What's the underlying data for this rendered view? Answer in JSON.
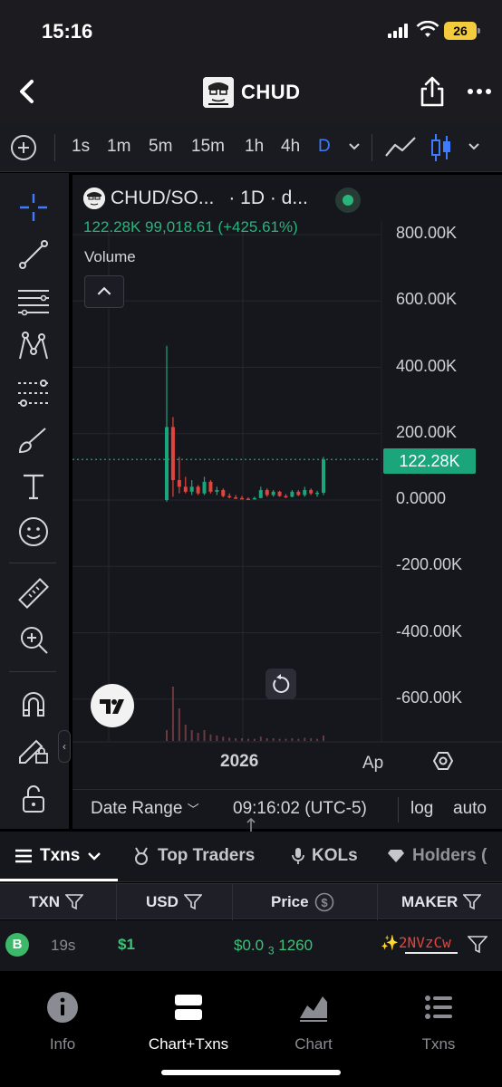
{
  "status": {
    "time": "15:16",
    "battery": "26"
  },
  "header": {
    "title": "CHUD"
  },
  "toolbar": {
    "timeframes": [
      "1s",
      "1m",
      "5m",
      "15m",
      "1h",
      "4h",
      "D"
    ],
    "active_timeframe": "D"
  },
  "chart": {
    "pair": "CHUD/SO...",
    "interval": "· 1D · d...",
    "ohlc": "122.28K  99,018.61 (+425.61%)",
    "volume_label": "Volume",
    "y_ticks": [
      "800.00K",
      "600.00K",
      "400.00K",
      "200.00K",
      "0.0000",
      "-200.00K",
      "-400.00K",
      "-600.00K"
    ],
    "last_price_tag": "122.28K",
    "x_ticks": [
      "2026",
      "Ap"
    ],
    "date_range": "Date Range",
    "time": "09:16:02 (UTC-5)",
    "log": "log",
    "auto": "auto"
  },
  "chart_data": {
    "type": "candlestick",
    "title": "CHUD/SO... · 1D",
    "ylim": [
      -700000,
      900000
    ],
    "y_ticks": [
      800000,
      600000,
      400000,
      200000,
      0,
      -200000,
      -400000,
      -600000
    ],
    "x_ticks": [
      "2026",
      "Ap"
    ],
    "last_value": 122280,
    "series": [
      {
        "name": "Price",
        "values": [
          {
            "o": 0,
            "h": 465000,
            "l": -5000,
            "c": 220000
          },
          {
            "o": 220000,
            "h": 250000,
            "l": 10000,
            "c": 60000
          },
          {
            "o": 60000,
            "h": 130000,
            "l": 20000,
            "c": 40000
          },
          {
            "o": 40000,
            "h": 70000,
            "l": 20000,
            "c": 25000
          },
          {
            "o": 25000,
            "h": 60000,
            "l": 15000,
            "c": 40000
          },
          {
            "o": 40000,
            "h": 45000,
            "l": 15000,
            "c": 20000
          },
          {
            "o": 20000,
            "h": 70000,
            "l": 15000,
            "c": 55000
          },
          {
            "o": 55000,
            "h": 60000,
            "l": 20000,
            "c": 25000
          },
          {
            "o": 25000,
            "h": 40000,
            "l": 15000,
            "c": 30000
          },
          {
            "o": 30000,
            "h": 35000,
            "l": 8000,
            "c": 12000
          },
          {
            "o": 12000,
            "h": 20000,
            "l": 5000,
            "c": 8000
          },
          {
            "o": 8000,
            "h": 15000,
            "l": 3000,
            "c": 6000
          },
          {
            "o": 6000,
            "h": 12000,
            "l": 2000,
            "c": 4000
          },
          {
            "o": 4000,
            "h": 8000,
            "l": 1000,
            "c": 3000
          },
          {
            "o": 3000,
            "h": 10000,
            "l": 1000,
            "c": 6000
          },
          {
            "o": 6000,
            "h": 40000,
            "l": 5000,
            "c": 30000
          },
          {
            "o": 30000,
            "h": 35000,
            "l": 10000,
            "c": 15000
          },
          {
            "o": 15000,
            "h": 30000,
            "l": 10000,
            "c": 25000
          },
          {
            "o": 25000,
            "h": 28000,
            "l": 10000,
            "c": 12000
          },
          {
            "o": 12000,
            "h": 18000,
            "l": 6000,
            "c": 10000
          },
          {
            "o": 10000,
            "h": 30000,
            "l": 8000,
            "c": 25000
          },
          {
            "o": 25000,
            "h": 30000,
            "l": 12000,
            "c": 15000
          },
          {
            "o": 15000,
            "h": 40000,
            "l": 10000,
            "c": 30000
          },
          {
            "o": 30000,
            "h": 35000,
            "l": 15000,
            "c": 20000
          },
          {
            "o": 20000,
            "h": 28000,
            "l": 10000,
            "c": 22000
          },
          {
            "o": 22000,
            "h": 130000,
            "l": 15000,
            "c": 122280
          }
        ]
      }
    ],
    "volume": [
      0.2,
      1.0,
      0.6,
      0.3,
      0.2,
      0.15,
      0.2,
      0.12,
      0.1,
      0.08,
      0.06,
      0.05,
      0.05,
      0.04,
      0.04,
      0.08,
      0.05,
      0.05,
      0.04,
      0.04,
      0.05,
      0.04,
      0.06,
      0.05,
      0.04,
      0.1
    ]
  },
  "tabs": [
    {
      "label": "Txns"
    },
    {
      "label": "Top Traders"
    },
    {
      "label": "KOLs"
    },
    {
      "label": "Holders ("
    }
  ],
  "table": {
    "headers": [
      "TXN",
      "USD",
      "Price",
      "MAKER"
    ],
    "row": {
      "type": "B",
      "age": "19s",
      "usd": "$1",
      "price_main": "$0.0",
      "price_zeros": "3",
      "price_tail": "1260",
      "maker": "2NVzCw"
    }
  },
  "bottom_nav": [
    {
      "label": "Info"
    },
    {
      "label": "Chart+Txns"
    },
    {
      "label": "Chart"
    },
    {
      "label": "Txns"
    }
  ],
  "colors": {
    "up": "#1aa57a",
    "down": "#e0443c",
    "accent": "#3e7bff",
    "buy": "#3cb869"
  }
}
